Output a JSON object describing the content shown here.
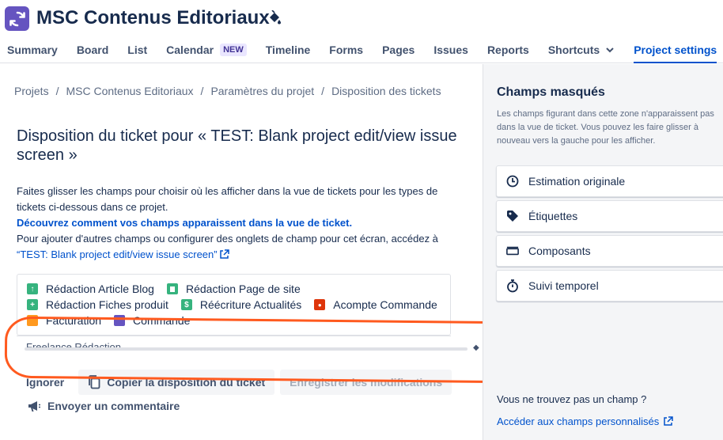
{
  "project": {
    "title": "MSC Contenus Editoriaux"
  },
  "nav": {
    "tabs": [
      {
        "label": "Summary"
      },
      {
        "label": "Board"
      },
      {
        "label": "List"
      },
      {
        "label": "Calendar",
        "badge": "NEW"
      },
      {
        "label": "Timeline"
      },
      {
        "label": "Forms"
      },
      {
        "label": "Pages"
      },
      {
        "label": "Issues"
      },
      {
        "label": "Reports"
      },
      {
        "label": "Shortcuts"
      },
      {
        "label": "Project settings",
        "active": true
      }
    ]
  },
  "breadcrumb": [
    "Projets",
    "MSC Contenus Editoriaux",
    "Paramètres du projet",
    "Disposition des tickets"
  ],
  "main": {
    "title": "Disposition du ticket pour « TEST: Blank project edit/view issue screen »",
    "desc_line1": "Faites glisser les champs pour choisir où les afficher dans la vue de tickets pour les types de tickets ci-dessous dans ce projet.",
    "desc_link": "Découvrez comment vos champs apparaissent dans la vue de ticket.",
    "desc_line2": "Pour ajouter d'autres champs ou configurer des onglets de champ pour cet écran, accédez à ",
    "screen_link": "“TEST: Blank project edit/view issue screen”",
    "field_peek": "Freelance Rédaction",
    "issue_types": [
      {
        "label": "Rédaction Article Blog",
        "color": "#36b37e",
        "glyph": "↑"
      },
      {
        "label": "Rédaction Page de site",
        "color": "#36b37e",
        "glyph": ""
      },
      {
        "label": "Rédaction Fiches produit",
        "color": "#36b37e",
        "glyph": "+"
      },
      {
        "label": "Réécriture Actualités",
        "color": "#36b37e",
        "glyph": "$"
      },
      {
        "label": "Acompte Commande",
        "color": "#de350b",
        "glyph": "●"
      },
      {
        "label": "Facturation",
        "color": "#ff991f",
        "glyph": ""
      },
      {
        "label": "Commande",
        "color": "#6554c0",
        "glyph": ""
      }
    ]
  },
  "actions": {
    "ignore": "Ignorer",
    "copy": "Copier la disposition du ticket",
    "save": "Enregistrer les modifications",
    "feedback": "Envoyer un commentaire"
  },
  "side": {
    "title": "Champs masqués",
    "desc": "Les champs figurant dans cette zone n'apparaissent pas dans la vue de ticket. Vous pouvez les faire glisser à nouveau vers la gauche pour les afficher.",
    "fields": [
      {
        "label": "Estimation originale",
        "icon": "clock-icon"
      },
      {
        "label": "Étiquettes",
        "icon": "tag-icon"
      },
      {
        "label": "Composants",
        "icon": "component-icon"
      },
      {
        "label": "Suivi temporel",
        "icon": "stopwatch-icon"
      }
    ],
    "foot": "Vous ne trouvez pas un champ ?",
    "link": "Accéder aux champs personnalisés"
  },
  "colors": {
    "accent": "#0052cc",
    "annotation": "#ff5a1f",
    "logo": "#6554c0"
  }
}
